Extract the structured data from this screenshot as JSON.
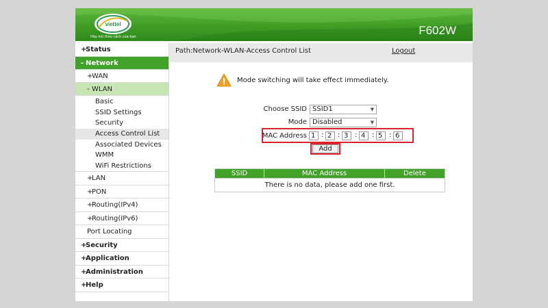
{
  "header": {
    "brand": "viettel",
    "slogan": "Hãy nói theo cách của bạn",
    "model": "F602W"
  },
  "sidebar": {
    "items": [
      {
        "sign": "+",
        "label": "Status"
      },
      {
        "sign": "-",
        "label": "Network"
      },
      {
        "sign": "+",
        "label": "WAN"
      },
      {
        "sign": "-",
        "label": "WLAN"
      },
      {
        "label": "Basic"
      },
      {
        "label": "SSID Settings"
      },
      {
        "label": "Security"
      },
      {
        "label": "Access Control List"
      },
      {
        "label": "Associated Devices"
      },
      {
        "label": "WMM"
      },
      {
        "label": "WiFi Restrictions"
      },
      {
        "sign": "+",
        "label": "LAN"
      },
      {
        "sign": "+",
        "label": "PON"
      },
      {
        "sign": "+",
        "label": "Routing(IPv4)"
      },
      {
        "sign": "+",
        "label": "Routing(IPv6)"
      },
      {
        "label": "Port Locating"
      },
      {
        "sign": "+",
        "label": "Security"
      },
      {
        "sign": "+",
        "label": "Application"
      },
      {
        "sign": "+",
        "label": "Administration"
      },
      {
        "sign": "+",
        "label": "Help"
      }
    ]
  },
  "pathbar": {
    "path": "Path:Network-WLAN-Access Control List",
    "logout": "Logout"
  },
  "notice": {
    "icon": "warning-icon",
    "text": "Mode switching will take effect immediately."
  },
  "form": {
    "ssid_label": "Choose SSID",
    "ssid_value": "SSID1",
    "mode_label": "Mode",
    "mode_value": "Disabled",
    "mac_label": "MAC Address",
    "mac_octets": [
      "1",
      "2",
      "3",
      "4",
      "5",
      "6"
    ],
    "colon": ":",
    "add_label": "Add"
  },
  "table": {
    "headers": [
      "SSID",
      "MAC Address",
      "Delete"
    ],
    "empty_message": "There is no data, please add one first."
  },
  "colors": {
    "brand_green": "#42a12a",
    "highlight_red": "#d9232d"
  }
}
